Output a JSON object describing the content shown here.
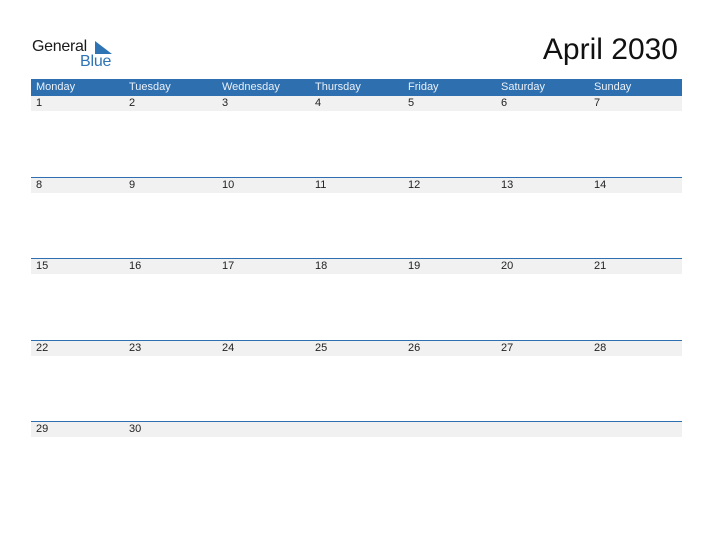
{
  "logo": {
    "text_general": "General",
    "text_blue": "Blue",
    "accent": "#2e74b5"
  },
  "title": "April 2030",
  "header_color": "#2e6fb0",
  "weekdays": [
    "Monday",
    "Tuesday",
    "Wednesday",
    "Thursday",
    "Friday",
    "Saturday",
    "Sunday"
  ],
  "weeks": [
    [
      "1",
      "2",
      "3",
      "4",
      "5",
      "6",
      "7"
    ],
    [
      "8",
      "9",
      "10",
      "11",
      "12",
      "13",
      "14"
    ],
    [
      "15",
      "16",
      "17",
      "18",
      "19",
      "20",
      "21"
    ],
    [
      "22",
      "23",
      "24",
      "25",
      "26",
      "27",
      "28"
    ],
    [
      "29",
      "30",
      "",
      "",
      "",
      "",
      ""
    ]
  ]
}
